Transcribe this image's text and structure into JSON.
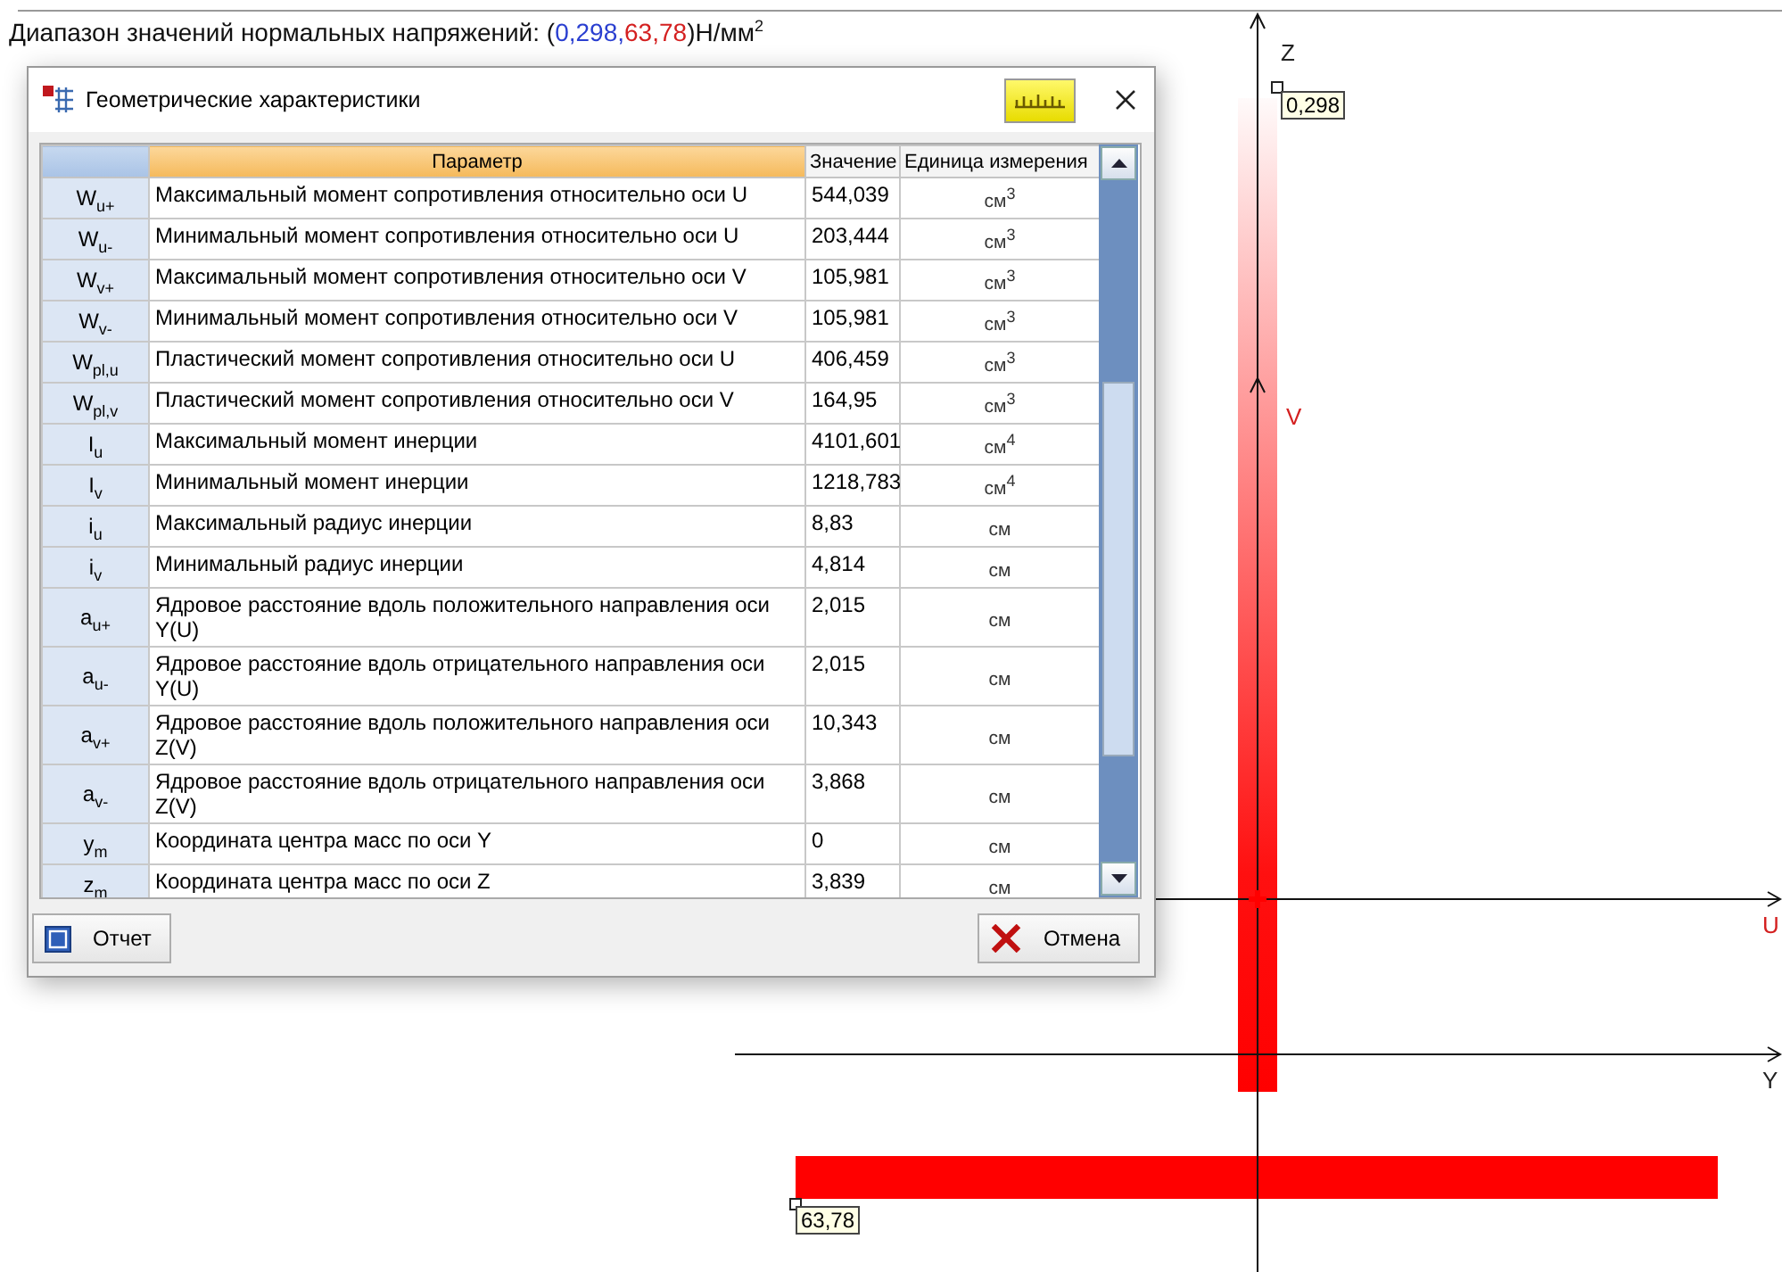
{
  "header": {
    "parts": [
      {
        "text": "Диапазон значений нормальных напряжений: (",
        "kind": "plain"
      },
      {
        "text": "0,298,",
        "kind": "min"
      },
      {
        "text": "63,78",
        "kind": "max"
      },
      {
        "text": ")Н/мм$^{2}$",
        "kind": "plain"
      }
    ]
  },
  "dialog": {
    "title": "Геометрические характеристики",
    "columns": [
      "Параметр",
      "Значение",
      "Единица измерения"
    ],
    "rows": [
      {
        "symbol": "W$_{u+}$",
        "parameter": "Максимальный момент сопротивления относительно оси U",
        "value": "544,039",
        "unit": "см$^{3}$"
      },
      {
        "symbol": "W$_{u-}$",
        "parameter": "Минимальный момент сопротивления относительно оси U",
        "value": "203,444",
        "unit": "см$^{3}$"
      },
      {
        "symbol": "W$_{v+}$",
        "parameter": "Максимальный момент сопротивления относительно оси V",
        "value": "105,981",
        "unit": "см$^{3}$"
      },
      {
        "symbol": "W$_{v-}$",
        "parameter": "Минимальный момент сопротивления относительно оси V",
        "value": "105,981",
        "unit": "см$^{3}$"
      },
      {
        "symbol": "W$_{pl,u}$",
        "parameter": "Пластический момент сопротивления относительно оси U",
        "value": "406,459",
        "unit": "см$^{3}$"
      },
      {
        "symbol": "W$_{pl,v}$",
        "parameter": "Пластический момент сопротивления относительно оси V",
        "value": "164,95",
        "unit": "см$^{3}$"
      },
      {
        "symbol": "I$_{u}$",
        "parameter": "Максимальный момент инерции",
        "value": "4101,601",
        "unit": "см$^{4}$"
      },
      {
        "symbol": "I$_{v}$",
        "parameter": "Минимальный момент инерции",
        "value": "1218,783",
        "unit": "см$^{4}$"
      },
      {
        "symbol": "i$_{u}$",
        "parameter": "Максимальный радиус инерции",
        "value": "8,83",
        "unit": "см"
      },
      {
        "symbol": "i$_{v}$",
        "parameter": "Минимальный радиус инерции",
        "value": "4,814",
        "unit": "см"
      },
      {
        "symbol": "a$_{u+}$",
        "parameter": "Ядровое расстояние вдоль положительного направления оси Y(U)",
        "value": "2,015",
        "unit": "см"
      },
      {
        "symbol": "a$_{u-}$",
        "parameter": "Ядровое расстояние вдоль отрицательного направления оси Y(U)",
        "value": "2,015",
        "unit": "см"
      },
      {
        "symbol": "a$_{v+}$",
        "parameter": "Ядровое расстояние вдоль положительного направления оси Z(V)",
        "value": "10,343",
        "unit": "см"
      },
      {
        "symbol": "a$_{v-}$",
        "parameter": "Ядровое расстояние вдоль отрицательного направления оси Z(V)",
        "value": "3,868",
        "unit": "см"
      },
      {
        "symbol": "y$_{m}$",
        "parameter": "Координата центра масс по оси Y",
        "value": "0",
        "unit": "см"
      },
      {
        "symbol": "z$_{m}$",
        "parameter": "Координата центра масс по оси Z",
        "value": "3,839",
        "unit": "см"
      }
    ],
    "buttons": [
      {
        "label": "Отчет",
        "kind": "report"
      },
      {
        "label": "Отмена",
        "kind": "cancel"
      }
    ]
  },
  "canvas": {
    "axes": [
      {
        "label": "Z",
        "kind": "global"
      },
      {
        "label": "V",
        "kind": "principal"
      },
      {
        "label": "U",
        "kind": "principal"
      },
      {
        "label": "Y",
        "kind": "global"
      }
    ],
    "value_labels": [
      "0,298",
      "63,78"
    ]
  }
}
